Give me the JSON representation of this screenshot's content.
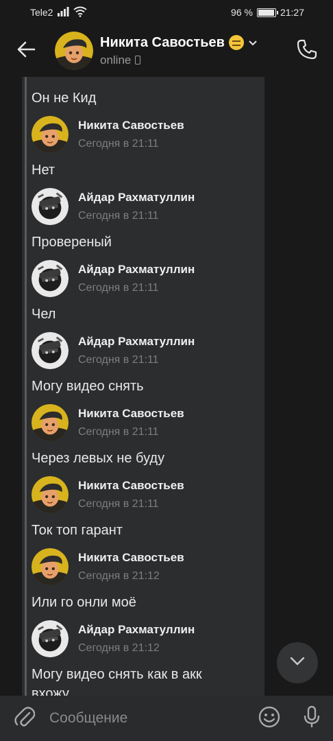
{
  "status_bar": {
    "carrier": "Tele2",
    "battery_percent": "96 %",
    "battery_level": 0.96,
    "time": "21:27"
  },
  "header": {
    "contact_name": "Никита Савостьев",
    "status": "online"
  },
  "messages": [
    {
      "text": "Он не Кид"
    },
    {
      "sender": "Никита Савостьев",
      "time": "Сегодня в 21:11",
      "text": "Нет",
      "avatar": "nikita"
    },
    {
      "sender": "Айдар Рахматуллин",
      "time": "Сегодня в 21:11",
      "text": "Провереный",
      "avatar": "aidar"
    },
    {
      "sender": "Айдар Рахматуллин",
      "time": "Сегодня в 21:11",
      "text": "Чел",
      "avatar": "aidar"
    },
    {
      "sender": "Айдар Рахматуллин",
      "time": "Сегодня в 21:11",
      "text": "Могу видео снять",
      "avatar": "aidar"
    },
    {
      "sender": "Никита Савостьев",
      "time": "Сегодня в 21:11",
      "text": "Через левых не буду",
      "avatar": "nikita"
    },
    {
      "sender": "Никита Савостьев",
      "time": "Сегодня в 21:11",
      "text": "Ток топ гарант",
      "avatar": "nikita"
    },
    {
      "sender": "Никита Савостьев",
      "time": "Сегодня в 21:12",
      "text": "Или го онли моё",
      "avatar": "nikita"
    },
    {
      "sender": "Айдар Рахматуллин",
      "time": "Сегодня в 21:12",
      "text": "Могу видео снять как в акк",
      "text_line2": "вхожу",
      "avatar": "aidar"
    }
  ],
  "composer": {
    "placeholder": "Сообщение"
  },
  "icons": {
    "back": "arrow-left-icon",
    "call": "phone-icon",
    "scroll": "chevron-down-icon",
    "attach": "paperclip-icon",
    "emoji": "smiley-icon",
    "mic": "microphone-icon"
  }
}
